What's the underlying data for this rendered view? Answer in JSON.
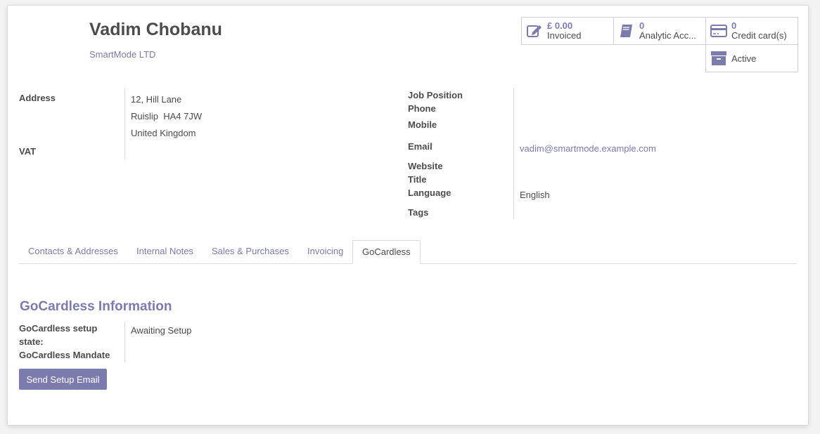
{
  "partner": {
    "name": "Vadim Chobanu",
    "company": "SmartMode LTD"
  },
  "smart_buttons": [
    {
      "value": "£ 0.00",
      "label": "Invoiced",
      "icon": "pencil-square-icon"
    },
    {
      "value": "0",
      "label": "Analytic Acc...",
      "icon": "book-icon"
    },
    {
      "value": "0",
      "label": "Credit card(s)",
      "icon": "credit-card-icon"
    },
    {
      "value": "",
      "label": "Active",
      "icon": "archive-icon"
    }
  ],
  "fields_left": {
    "address_label": "Address",
    "address_line1": "12, Hill Lane",
    "address_line2": "Ruislip  HA4 7JW",
    "address_line3": "United Kingdom",
    "vat_label": "VAT"
  },
  "fields_right": {
    "job_position_label": "Job Position",
    "phone_label": "Phone",
    "mobile_label": "Mobile",
    "email_label": "Email",
    "email_value": "vadim@smartmode.example.com",
    "website_label": "Website",
    "title_label": "Title",
    "language_label": "Language",
    "language_value": "English",
    "tags_label": "Tags"
  },
  "tabs": [
    {
      "label": "Contacts & Addresses"
    },
    {
      "label": "Internal Notes"
    },
    {
      "label": "Sales & Purchases"
    },
    {
      "label": "Invoicing"
    },
    {
      "label": "GoCardless",
      "active": true
    }
  ],
  "gocardless": {
    "section_title": "GoCardless Information",
    "setup_state_label_1": "GoCardless setup",
    "setup_state_label_2": "state:",
    "setup_state_value": "Awaiting Setup",
    "mandate_label": "GoCardless Mandate",
    "send_button": "Send Setup Email"
  },
  "colors": {
    "accent": "#7c7bad",
    "active": "#28a745",
    "text": "#4c4c4c"
  }
}
